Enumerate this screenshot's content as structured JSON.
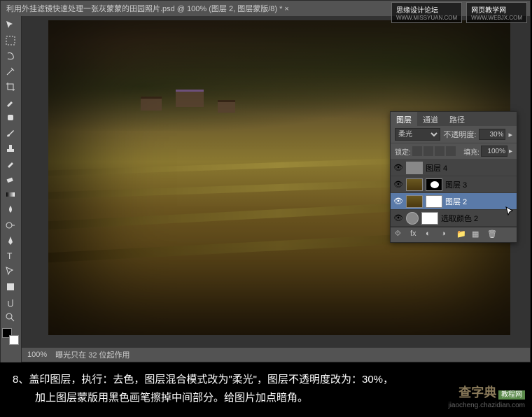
{
  "titlebar": {
    "text": "利用外挂滤镜快速处理一张灰蒙蒙的田园照片.psd @ 100% (图层 2, 图层蒙版/8) * ×"
  },
  "statusbar": {
    "zoom": "100%",
    "info": "曝光只在 32 位起作用"
  },
  "panel": {
    "tabs": {
      "layers": "图层",
      "channels": "通道",
      "paths": "路径"
    },
    "blend_label": "",
    "blend_mode": "柔光",
    "opacity_label": "不透明度:",
    "opacity_value": "30%",
    "lock_label": "锁定:",
    "fill_label": "填充:",
    "fill_value": "100%",
    "layers": [
      {
        "name": "图层 4",
        "selected": false,
        "mask": false,
        "gray": true
      },
      {
        "name": "图层 3",
        "selected": false,
        "mask": true,
        "maskDark": true
      },
      {
        "name": "图层 2",
        "selected": true,
        "mask": true
      },
      {
        "name": "选取颜色 2",
        "selected": false,
        "adj": true,
        "mask": true
      }
    ]
  },
  "watermarks": {
    "top1": "思缘设计论坛",
    "top1_sub": "WWW.MISSYUAN.COM",
    "top2": "网页教学网",
    "top2_sub": "WWW.WEBJX.COM",
    "bottom_logo": "查字典",
    "bottom_tag": "教程网",
    "bottom_url": "jiaocheng.chazidian.com"
  },
  "instructions": {
    "line1": "8、盖印图层，执行：去色，图层混合模式改为\"柔光\"，图层不透明度改为：30%，",
    "line2": "加上图层蒙版用黑色画笔擦掉中间部分。给图片加点暗角。"
  }
}
